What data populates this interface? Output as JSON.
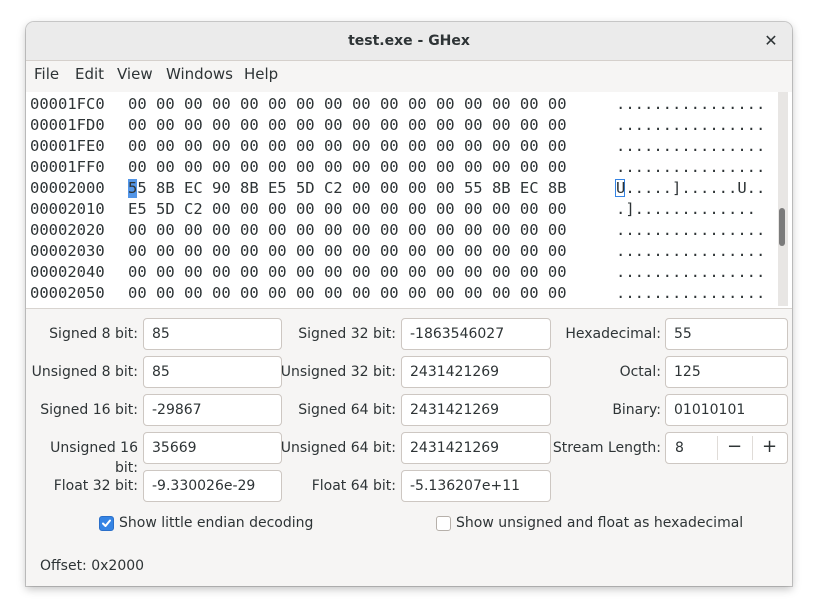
{
  "window": {
    "title": "test.exe - GHex",
    "close_glyph": "✕"
  },
  "menu": [
    "File",
    "Edit",
    "View",
    "Windows",
    "Help"
  ],
  "hex_rows": [
    {
      "addr": "00001FC0",
      "hex": "00 00 00 00 00 00 00 00 00 00 00 00 00 00 00 00",
      "ascii": "................"
    },
    {
      "addr": "00001FD0",
      "hex": "00 00 00 00 00 00 00 00 00 00 00 00 00 00 00 00",
      "ascii": "................"
    },
    {
      "addr": "00001FE0",
      "hex": "00 00 00 00 00 00 00 00 00 00 00 00 00 00 00 00",
      "ascii": "................"
    },
    {
      "addr": "00001FF0",
      "hex": "00 00 00 00 00 00 00 00 00 00 00 00 00 00 00 00",
      "ascii": "................"
    },
    {
      "addr": "00002000",
      "hex": "55 8B EC 90 8B E5 5D C2 00 00 00 00 55 8B EC 8B",
      "ascii": "U.....]......U.."
    },
    {
      "addr": "00002010",
      "hex": "E5 5D C2 00 00 00 00 00 00 00 00 00 00 00 00 00",
      "ascii": ".]............."
    },
    {
      "addr": "00002020",
      "hex": "00 00 00 00 00 00 00 00 00 00 00 00 00 00 00 00",
      "ascii": "................"
    },
    {
      "addr": "00002030",
      "hex": "00 00 00 00 00 00 00 00 00 00 00 00 00 00 00 00",
      "ascii": "................"
    },
    {
      "addr": "00002040",
      "hex": "00 00 00 00 00 00 00 00 00 00 00 00 00 00 00 00",
      "ascii": "................"
    },
    {
      "addr": "00002050",
      "hex": "00 00 00 00 00 00 00 00 00 00 00 00 00 00 00 00",
      "ascii": "................"
    }
  ],
  "cursor": {
    "row_addr": "00002000",
    "byte": "55",
    "ascii_char": "U"
  },
  "decoding": {
    "signed8": {
      "label": "Signed 8 bit:",
      "value": "85"
    },
    "unsigned8": {
      "label": "Unsigned 8 bit:",
      "value": "85"
    },
    "signed16": {
      "label": "Signed 16 bit:",
      "value": "-29867"
    },
    "unsigned16": {
      "label": "Unsigned 16 bit:",
      "value": "35669"
    },
    "float32": {
      "label": "Float 32 bit:",
      "value": "-9.330026e-29"
    },
    "signed32": {
      "label": "Signed 32 bit:",
      "value": "-1863546027"
    },
    "unsigned32": {
      "label": "Unsigned 32 bit:",
      "value": "2431421269"
    },
    "signed64": {
      "label": "Signed 64 bit:",
      "value": "2431421269"
    },
    "unsigned64": {
      "label": "Unsigned 64 bit:",
      "value": "2431421269"
    },
    "float64": {
      "label": "Float 64 bit:",
      "value": "-5.136207e+11"
    },
    "hexadecimal": {
      "label": "Hexadecimal:",
      "value": "55"
    },
    "octal": {
      "label": "Octal:",
      "value": "125"
    },
    "binary": {
      "label": "Binary:",
      "value": "01010101"
    },
    "stream_length": {
      "label": "Stream Length:",
      "value": "8",
      "minus": "−",
      "plus": "+"
    }
  },
  "options": {
    "little_endian": {
      "label": "Show little endian decoding",
      "checked": true
    },
    "unsigned_hex": {
      "label": "Show unsigned and float as hexadecimal",
      "checked": false
    }
  },
  "status": {
    "offset": "Offset: 0x2000"
  },
  "colors": {
    "accent": "#3584e4",
    "window_bg": "#f6f5f4",
    "titlebar_bg": "#ebebeb"
  }
}
